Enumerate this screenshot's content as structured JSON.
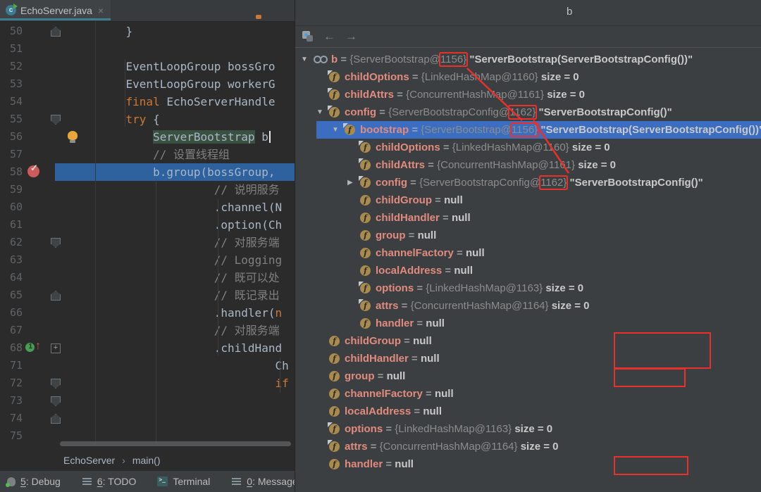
{
  "editor": {
    "tab": {
      "title": "EchoServer.java",
      "close": "×"
    },
    "breadcrumb": {
      "class": "EchoServer",
      "sep": "›",
      "method": "main()"
    },
    "lines": [
      {
        "n": 50,
        "segs": [
          [
            "    }",
            "c"
          ]
        ],
        "fold": "up"
      },
      {
        "n": 51,
        "segs": []
      },
      {
        "n": 52,
        "segs": [
          [
            "    EventLoopGroup bossGro",
            "c"
          ]
        ]
      },
      {
        "n": 53,
        "segs": [
          [
            "    EventLoopGroup workerG",
            "c"
          ]
        ]
      },
      {
        "n": 54,
        "segs": [
          [
            "    ",
            "c"
          ],
          [
            "final",
            "k"
          ],
          [
            " EchoServerHandle",
            "c"
          ]
        ]
      },
      {
        "n": 55,
        "segs": [
          [
            "    ",
            "c"
          ],
          [
            "try",
            "k"
          ],
          [
            " {",
            "c"
          ]
        ],
        "fold": "down"
      },
      {
        "n": 56,
        "segs": [
          [
            "        ",
            "c"
          ],
          [
            "ServerBootstrap",
            "h"
          ],
          [
            " b",
            "c"
          ]
        ],
        "icon": "bulb",
        "caret": true
      },
      {
        "n": 57,
        "segs": [
          [
            "        ",
            "c"
          ],
          [
            "// 设置线程组",
            "m"
          ]
        ]
      },
      {
        "n": 58,
        "segs": [
          [
            "        b.group(bossGroup,",
            "c"
          ]
        ],
        "icon": "bp",
        "exec": true
      },
      {
        "n": 59,
        "segs": [
          [
            "                 ",
            "c"
          ],
          [
            "// 说明服务",
            "m"
          ]
        ]
      },
      {
        "n": 60,
        "segs": [
          [
            "                 .channel(N",
            "c"
          ]
        ]
      },
      {
        "n": 61,
        "segs": [
          [
            "                 .option(Ch",
            "c"
          ]
        ]
      },
      {
        "n": 62,
        "segs": [
          [
            "                 ",
            "c"
          ],
          [
            "// 对服务端",
            "m"
          ]
        ],
        "fold": "down"
      },
      {
        "n": 63,
        "segs": [
          [
            "                 ",
            "c"
          ],
          [
            "// Logging",
            "m"
          ]
        ]
      },
      {
        "n": 64,
        "segs": [
          [
            "                 ",
            "c"
          ],
          [
            "// 既可以处",
            "m"
          ]
        ]
      },
      {
        "n": 65,
        "segs": [
          [
            "                 ",
            "c"
          ],
          [
            "// 既记录出",
            "m"
          ]
        ],
        "fold": "up"
      },
      {
        "n": 66,
        "segs": [
          [
            "                 .handler(",
            "c"
          ],
          [
            "n",
            "k"
          ]
        ]
      },
      {
        "n": 67,
        "segs": [
          [
            "                 ",
            "c"
          ],
          [
            "// 对服务端",
            "m"
          ]
        ]
      },
      {
        "n": 68,
        "segs": [
          [
            "                 .childHand",
            "c"
          ]
        ],
        "icon": "g1",
        "fold": "plus"
      },
      {
        "n": 71,
        "segs": [
          [
            "                          Ch",
            "c"
          ]
        ]
      },
      {
        "n": 72,
        "segs": [
          [
            "                          ",
            "c"
          ],
          [
            "if",
            "k"
          ]
        ],
        "fold": "down"
      },
      {
        "n": 73,
        "segs": [],
        "fold": "down"
      },
      {
        "n": 74,
        "segs": [],
        "fold": "up"
      },
      {
        "n": 75,
        "segs": []
      }
    ]
  },
  "statusbar": {
    "items": [
      {
        "name": "debug",
        "key": "5",
        "label": ": Debug"
      },
      {
        "name": "todo",
        "key": "6",
        "label": ": TODO"
      },
      {
        "name": "terminal",
        "key": "",
        "label": "Terminal"
      },
      {
        "name": "messages",
        "key": "0",
        "label": ": Messages"
      }
    ]
  },
  "panel": {
    "title": "b",
    "toolbar": {
      "back": "←",
      "forward": "→"
    },
    "rows": [
      {
        "lvl": 0,
        "exp": "d",
        "ico": "w",
        "parts": [
          [
            "b",
            "name"
          ],
          [
            " = ",
            "eq"
          ],
          [
            "{ServerBootstrap@",
            "ref"
          ],
          [
            "1156}",
            "idbox"
          ],
          [
            " ",
            "eq"
          ],
          [
            "\"ServerBootstrap(ServerBootstrapConfig())\"",
            "val"
          ]
        ]
      },
      {
        "lvl": 1,
        "ico": "ff",
        "parts": [
          [
            "childOptions",
            "name"
          ],
          [
            " = ",
            "eq"
          ],
          [
            "{LinkedHashMap@1160} ",
            "ref"
          ],
          [
            "size = 0",
            "val"
          ]
        ]
      },
      {
        "lvl": 1,
        "ico": "ff",
        "parts": [
          [
            "childAttrs",
            "name"
          ],
          [
            " = ",
            "eq"
          ],
          [
            "{ConcurrentHashMap@1161} ",
            "ref"
          ],
          [
            "size = 0",
            "val"
          ]
        ]
      },
      {
        "lvl": 1,
        "exp": "d",
        "ico": "ff",
        "parts": [
          [
            "config",
            "name"
          ],
          [
            " = ",
            "eq"
          ],
          [
            "{ServerBootstrapConfig@",
            "ref"
          ],
          [
            "1162}",
            "idbox"
          ],
          [
            " ",
            "eq"
          ],
          [
            "\"ServerBootstrapConfig()\"",
            "val"
          ]
        ]
      },
      {
        "lvl": 2,
        "exp": "d",
        "ico": "ff",
        "sel": true,
        "parts": [
          [
            "bootstrap",
            "name"
          ],
          [
            " = ",
            "eq"
          ],
          [
            "{ServerBootstrap@",
            "ref"
          ],
          [
            "1156}",
            "idbox"
          ],
          [
            " ",
            "eq"
          ],
          [
            "\"ServerBootstrap(ServerBootstrapConfig())\"",
            "val"
          ]
        ]
      },
      {
        "lvl": 3,
        "ico": "ff",
        "parts": [
          [
            "childOptions",
            "name"
          ],
          [
            " = ",
            "eq"
          ],
          [
            "{LinkedHashMap@1160} ",
            "ref"
          ],
          [
            "size = 0",
            "val"
          ]
        ]
      },
      {
        "lvl": 3,
        "ico": "ff",
        "parts": [
          [
            "childAttrs",
            "name"
          ],
          [
            " = ",
            "eq"
          ],
          [
            "{ConcurrentHashMap@1161} ",
            "ref"
          ],
          [
            "size = 0",
            "val"
          ]
        ]
      },
      {
        "lvl": 3,
        "exp": "r",
        "ico": "ff",
        "parts": [
          [
            "config",
            "name"
          ],
          [
            " = ",
            "eq"
          ],
          [
            "{ServerBootstrapConfig@",
            "ref"
          ],
          [
            "1162}",
            "idbox"
          ],
          [
            " ",
            "eq"
          ],
          [
            "\"ServerBootstrapConfig()\"",
            "val"
          ]
        ]
      },
      {
        "lvl": 3,
        "ico": "f",
        "parts": [
          [
            "childGroup",
            "name"
          ],
          [
            " = ",
            "eq"
          ],
          [
            "null",
            "val"
          ]
        ]
      },
      {
        "lvl": 3,
        "ico": "f",
        "parts": [
          [
            "childHandler",
            "name"
          ],
          [
            " = ",
            "eq"
          ],
          [
            "null",
            "val"
          ]
        ]
      },
      {
        "lvl": 3,
        "ico": "f",
        "parts": [
          [
            "group",
            "name"
          ],
          [
            " = ",
            "eq"
          ],
          [
            "null",
            "val"
          ]
        ]
      },
      {
        "lvl": 3,
        "ico": "f",
        "parts": [
          [
            "channelFactory",
            "name"
          ],
          [
            " = ",
            "eq"
          ],
          [
            "null",
            "val"
          ]
        ]
      },
      {
        "lvl": 3,
        "ico": "f",
        "parts": [
          [
            "localAddress",
            "name"
          ],
          [
            " = ",
            "eq"
          ],
          [
            "null",
            "val"
          ]
        ]
      },
      {
        "lvl": 3,
        "ico": "ff",
        "parts": [
          [
            "options",
            "name"
          ],
          [
            " = ",
            "eq"
          ],
          [
            "{LinkedHashMap@1163} ",
            "ref"
          ],
          [
            "size = 0",
            "val"
          ]
        ]
      },
      {
        "lvl": 3,
        "ico": "ff",
        "parts": [
          [
            "attrs",
            "name"
          ],
          [
            " = ",
            "eq"
          ],
          [
            "{ConcurrentHashMap@1164} ",
            "ref"
          ],
          [
            "size = 0",
            "val"
          ]
        ]
      },
      {
        "lvl": 3,
        "ico": "f",
        "parts": [
          [
            "handler",
            "name"
          ],
          [
            " = ",
            "eq"
          ],
          [
            "null",
            "val"
          ]
        ]
      },
      {
        "lvl": 1,
        "ico": "f",
        "parts": [
          [
            "childGroup",
            "name"
          ],
          [
            " = ",
            "eq"
          ],
          [
            "null",
            "val"
          ]
        ]
      },
      {
        "lvl": 1,
        "ico": "f",
        "parts": [
          [
            "childHandler",
            "name"
          ],
          [
            " = ",
            "eq"
          ],
          [
            "null",
            "val"
          ]
        ]
      },
      {
        "lvl": 1,
        "ico": "f",
        "parts": [
          [
            "group",
            "name"
          ],
          [
            " = ",
            "eq"
          ],
          [
            "null",
            "val"
          ]
        ]
      },
      {
        "lvl": 1,
        "ico": "f",
        "parts": [
          [
            "channelFactory",
            "name"
          ],
          [
            " = ",
            "eq"
          ],
          [
            "null",
            "val"
          ]
        ]
      },
      {
        "lvl": 1,
        "ico": "f",
        "parts": [
          [
            "localAddress",
            "name"
          ],
          [
            " = ",
            "eq"
          ],
          [
            "null",
            "val"
          ]
        ]
      },
      {
        "lvl": 1,
        "ico": "ff",
        "parts": [
          [
            "options",
            "name"
          ],
          [
            " = ",
            "eq"
          ],
          [
            "{LinkedHashMap@1163} ",
            "ref"
          ],
          [
            "size = 0",
            "val"
          ]
        ]
      },
      {
        "lvl": 1,
        "ico": "ff",
        "parts": [
          [
            "attrs",
            "name"
          ],
          [
            " = ",
            "eq"
          ],
          [
            "{ConcurrentHashMap@1164} ",
            "ref"
          ],
          [
            "size = 0",
            "val"
          ]
        ]
      },
      {
        "lvl": 1,
        "ico": "f",
        "parts": [
          [
            "handler",
            "name"
          ],
          [
            " = ",
            "eq"
          ],
          [
            "null",
            "val"
          ]
        ]
      }
    ]
  },
  "colors": {
    "annotation_red": "#e8312b",
    "selection_blue": "#3b6ec1",
    "execution_blue": "#2d629e",
    "tab_underline": "#3e7e91"
  }
}
